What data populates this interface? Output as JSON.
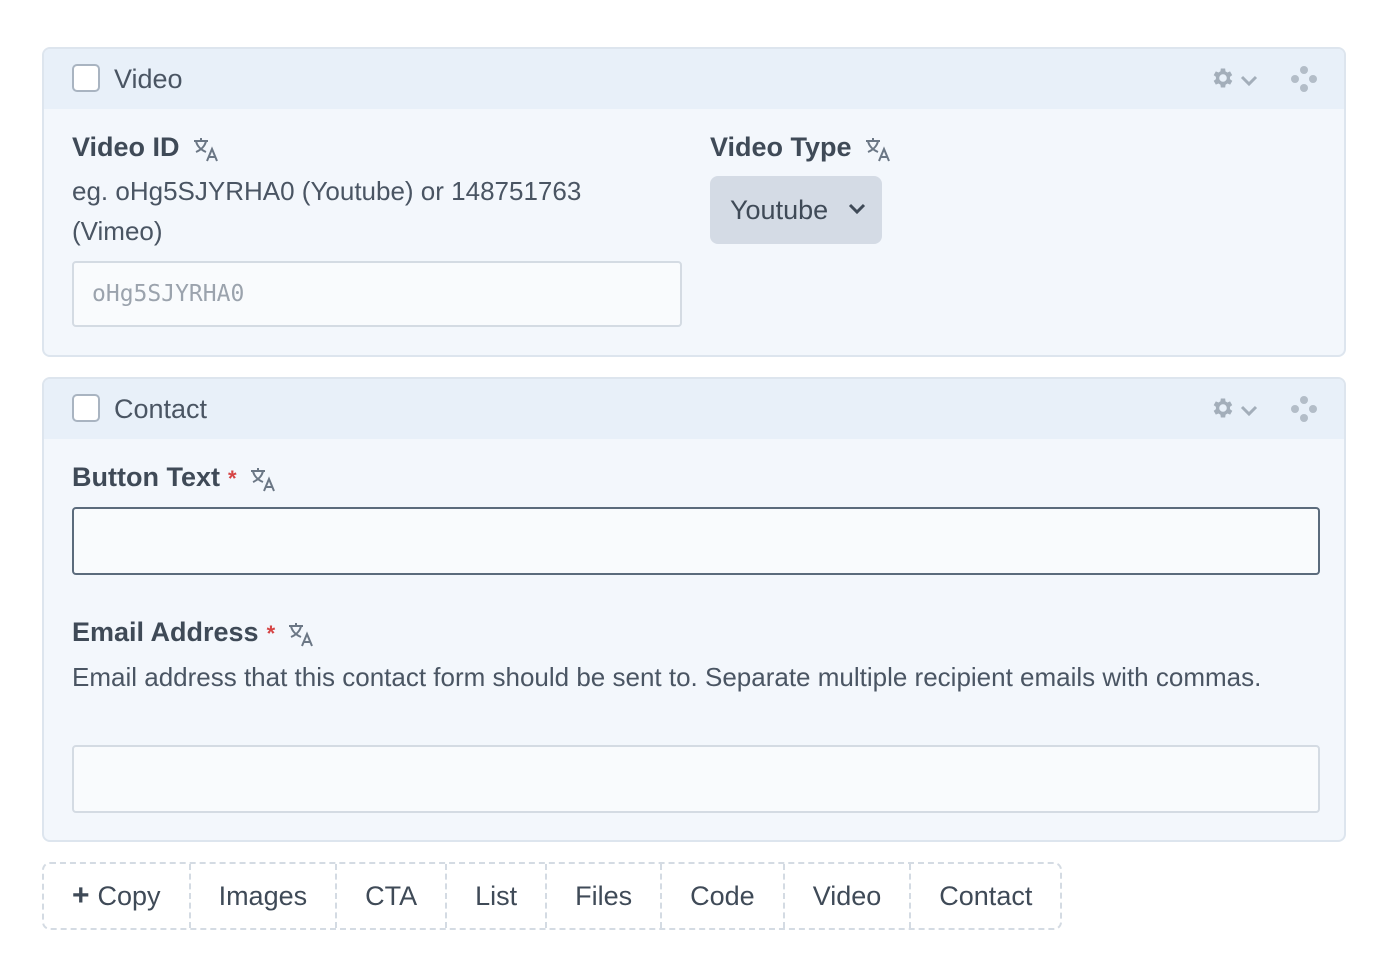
{
  "video_block": {
    "title": "Video",
    "video_id": {
      "label": "Video ID",
      "help": "eg. oHg5SJYRHA0 (Youtube) or 148751763 (Vimeo)",
      "placeholder": "oHg5SJYRHA0"
    },
    "video_type": {
      "label": "Video Type",
      "selected": "Youtube"
    }
  },
  "contact_block": {
    "title": "Contact",
    "button_text": {
      "label": "Button Text",
      "required_mark": "*",
      "value": ""
    },
    "email": {
      "label": "Email Address",
      "required_mark": "*",
      "help": "Email address that this contact form should be sent to. Separate multiple recipient emails with commas.",
      "value": ""
    }
  },
  "toolbar": {
    "plus": "+",
    "items": [
      "Copy",
      "Images",
      "CTA",
      "List",
      "Files",
      "Code",
      "Video",
      "Contact"
    ]
  },
  "icons": {
    "translate": "translate-icon",
    "gear": "gear-icon",
    "chevron": "chevron-down-icon",
    "drag": "drag-handle-icon",
    "plus": "plus-icon"
  },
  "colors": {
    "block_bg": "#f3f7fc",
    "header_bg": "#e8f0f9",
    "required": "#d64545",
    "select_bg": "#d4dbe5"
  }
}
